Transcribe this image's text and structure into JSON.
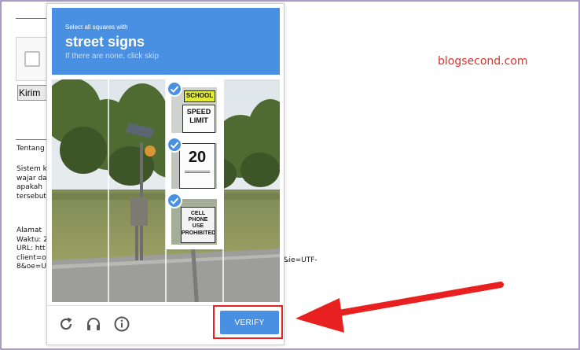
{
  "page": {
    "kirim_label": "Kirim",
    "tentang": "Tentang",
    "paragraph": "Sistem k\nwajar da\napakah\ntersebut",
    "alamat": "Alamat\nWaktu: 2\nURL: htt\nclient=o\n8&oe=U",
    "url_tail": "a&ie=UTF-",
    "watermark": "blogsecond.com"
  },
  "captcha": {
    "instruction": "Select all squares with",
    "target": "street signs",
    "hint": "If there are none, click skip",
    "verify_label": "VERIFY",
    "selected_tiles": 3
  },
  "sign_text": {
    "school": "SCHOOL",
    "speed": "SPEED",
    "limit": "LIMIT",
    "speed_value": "20",
    "cell_1": "CELL PHONE",
    "cell_2": "USE",
    "cell_3": "PROHIBITED"
  },
  "icons": [
    "reload-icon",
    "headphones-icon",
    "info-icon",
    "checkmark-icon"
  ],
  "colors": {
    "accent": "#4a90e2",
    "highlight": "#e8201f",
    "watermark": "#d9322b"
  }
}
